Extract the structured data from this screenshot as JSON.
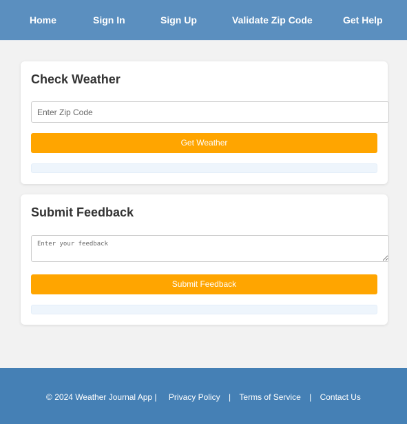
{
  "nav": {
    "items": [
      {
        "label": "Home"
      },
      {
        "label": "Sign In"
      },
      {
        "label": "Sign Up"
      },
      {
        "label": "Validate Zip Code"
      },
      {
        "label": "Get Help"
      }
    ]
  },
  "weather": {
    "title": "Check Weather",
    "zip_placeholder": "Enter Zip Code",
    "zip_value": "",
    "button_label": "Get Weather",
    "result_text": ""
  },
  "feedback": {
    "title": "Submit Feedback",
    "placeholder": "Enter your feedback",
    "value": "",
    "button_label": "Submit Feedback",
    "result_text": ""
  },
  "footer": {
    "copyright": "© 2024 Weather Journal App |",
    "separator": "|",
    "links": [
      {
        "label": "Privacy Policy"
      },
      {
        "label": "Terms of Service"
      },
      {
        "label": "Contact Us"
      }
    ]
  },
  "colors": {
    "header_bg": "#5b8fbf",
    "footer_bg": "#4580b5",
    "accent_button": "#ffa500",
    "page_bg": "#f2f2f2",
    "result_bg": "#eef5fc"
  }
}
